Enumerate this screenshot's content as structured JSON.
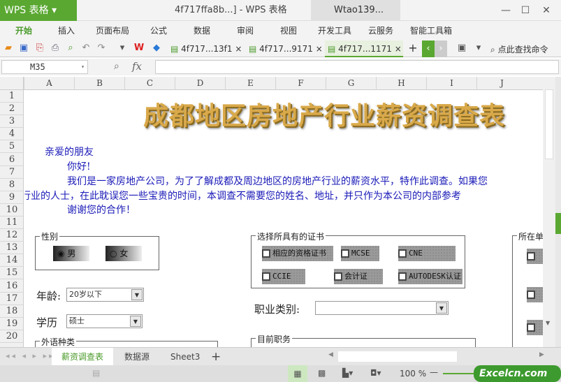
{
  "app": {
    "logo": "WPS 表格",
    "title": "4f717ffa8b...] - WPS 表格",
    "user": "Wtao139...",
    "window_buttons": [
      "—",
      "☐",
      "✕"
    ]
  },
  "menu": [
    "开始",
    "插入",
    "页面布局",
    "公式",
    "数据",
    "审阅",
    "视图",
    "开发工具",
    "云服务",
    "智能工具箱"
  ],
  "doc_tabs": [
    "4f717...13f1",
    "4f717...9171",
    "4f717...1171"
  ],
  "search_cmd": "点此查找命令",
  "formula": {
    "name_box": "M35",
    "fx": "fx",
    "value": ""
  },
  "columns": [
    "A",
    "B",
    "C",
    "D",
    "E",
    "F",
    "G",
    "H",
    "I",
    "J"
  ],
  "rows": [
    "1",
    "2",
    "3",
    "4",
    "5",
    "6",
    "7",
    "8",
    "9",
    "10",
    "11",
    "12",
    "13",
    "14",
    "15",
    "16",
    "17",
    "18",
    "19",
    "20"
  ],
  "sheet": {
    "title": "成都地区房地产行业薪资调查表",
    "letter": [
      "亲爱的朋友",
      "你好!",
      "我们是一家房地产公司，为了了解成都及周边地区的房地产行业的薪资水平，特作此调查。如果您",
      "行业的人士，在此耽误您一些宝贵的时间，本调查不需要您的姓名、地址，并只作为本公司的内部参考",
      "谢谢您的合作！"
    ],
    "gender": {
      "label": "性别",
      "options": [
        "男",
        "女"
      ],
      "selected": "男"
    },
    "certs": {
      "label": "选择所具有的证书",
      "options": [
        "相应的资格证书",
        "MCSE",
        "CNE",
        "CCIE",
        "会计证",
        "AUTODESK认证"
      ]
    },
    "age": {
      "label": "年龄:",
      "value": "20岁以下"
    },
    "education": {
      "label": "学历",
      "value": "硕士"
    },
    "job_type": {
      "label": "职业类别:",
      "value": ""
    },
    "language": {
      "label": "外语种类"
    },
    "position": {
      "label": "目前职务"
    },
    "location": {
      "label": "所在单"
    }
  },
  "sheet_tabs": [
    "薪资调查表",
    "数据源",
    "Sheet3"
  ],
  "add_tab": "+",
  "zoom": "100 %",
  "watermark": "Excelcn.com"
}
